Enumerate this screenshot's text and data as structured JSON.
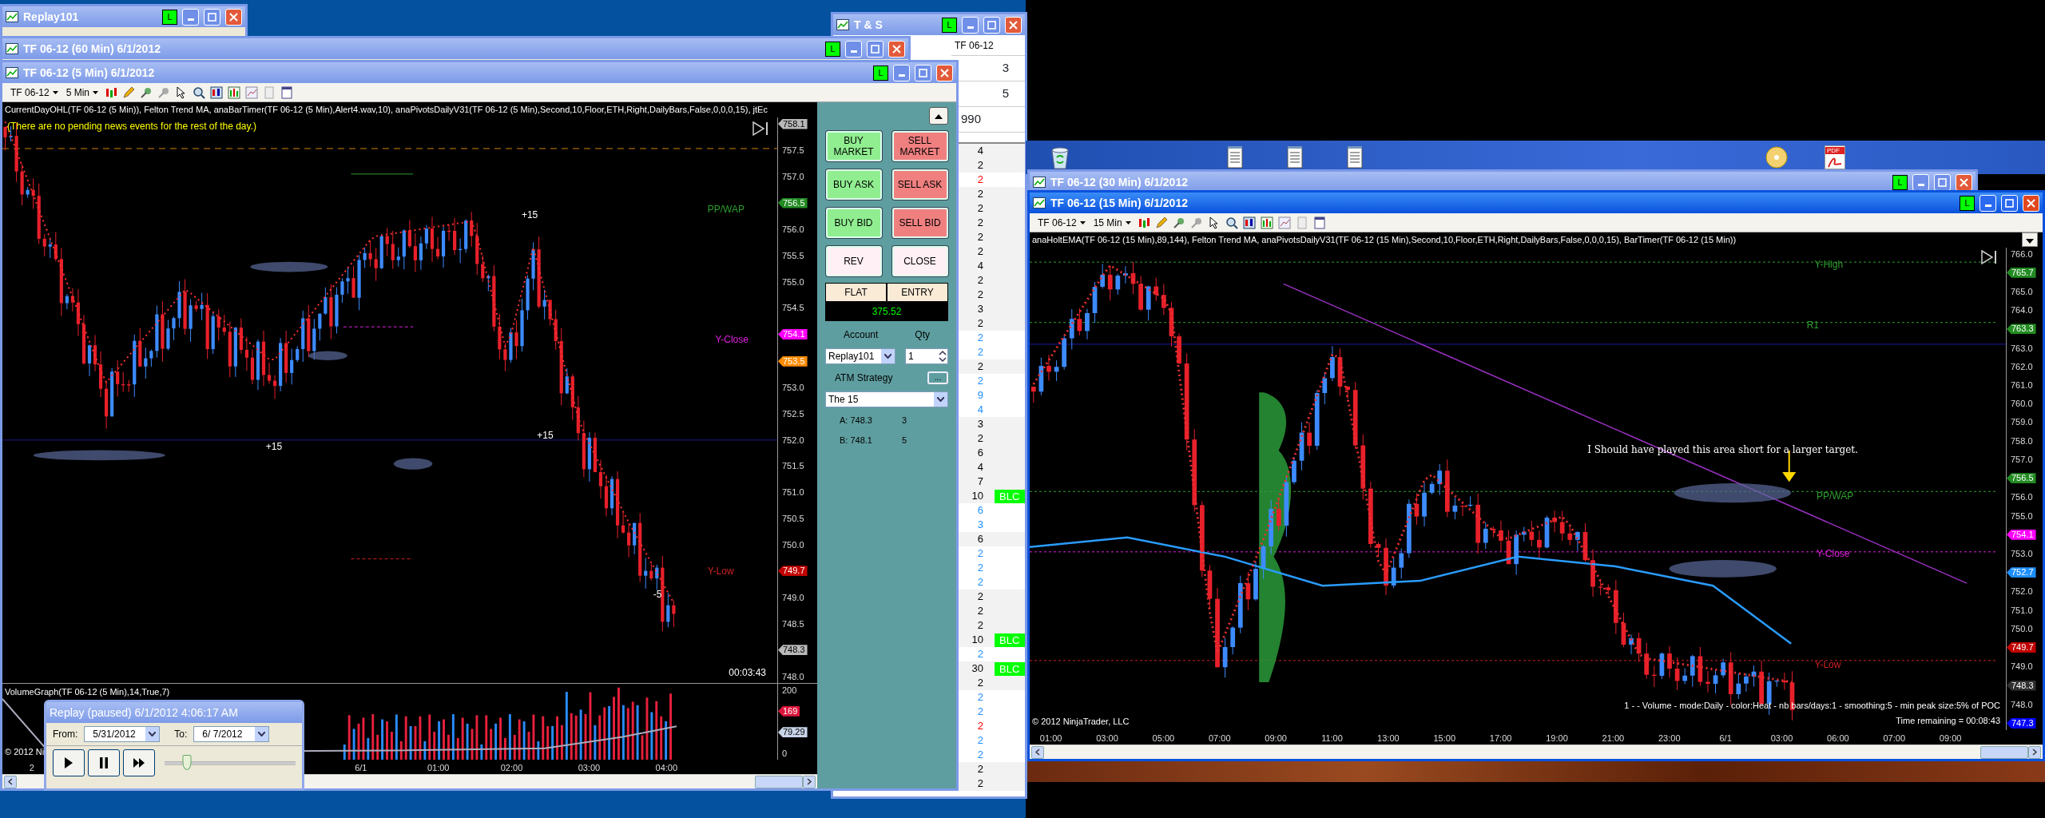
{
  "replay_window": {
    "title": "Replay101",
    "link": "L",
    "active": false
  },
  "ts_window": {
    "title": "T & S",
    "link": "L",
    "active": false,
    "instrument": "TF 06-12",
    "header_rows": [
      "3",
      "5",
      "990"
    ],
    "rows": [
      {
        "size": "4",
        "color": "#000000"
      },
      {
        "size": "2",
        "color": "#000000"
      },
      {
        "size": "2",
        "color": "#ff0000"
      },
      {
        "size": "2",
        "color": "#000000"
      },
      {
        "size": "2",
        "color": "#000000"
      },
      {
        "size": "2",
        "color": "#000000"
      },
      {
        "size": "2",
        "color": "#000000"
      },
      {
        "size": "2",
        "color": "#000000"
      },
      {
        "size": "4",
        "color": "#000000"
      },
      {
        "size": "2",
        "color": "#000000"
      },
      {
        "size": "2",
        "color": "#000000"
      },
      {
        "size": "3",
        "color": "#000000"
      },
      {
        "size": "2",
        "color": "#000000"
      },
      {
        "size": "2",
        "color": "#1e8fff"
      },
      {
        "size": "2",
        "color": "#1e8fff"
      },
      {
        "size": "2",
        "color": "#000000"
      },
      {
        "size": "2",
        "color": "#1e8fff"
      },
      {
        "size": "9",
        "color": "#1e8fff"
      },
      {
        "size": "4",
        "color": "#1e8fff"
      },
      {
        "size": "3",
        "color": "#000000"
      },
      {
        "size": "2",
        "color": "#000000"
      },
      {
        "size": "6",
        "color": "#000000"
      },
      {
        "size": "4",
        "color": "#000000"
      },
      {
        "size": "7",
        "color": "#000000"
      },
      {
        "size": "10",
        "color": "#000000",
        "tag": "BLC"
      },
      {
        "size": "6",
        "color": "#1e8fff"
      },
      {
        "size": "3",
        "color": "#1e8fff"
      },
      {
        "size": "6",
        "color": "#000000"
      },
      {
        "size": "2",
        "color": "#1e8fff"
      },
      {
        "size": "2",
        "color": "#1e8fff"
      },
      {
        "size": "2",
        "color": "#1e8fff"
      },
      {
        "size": "2",
        "color": "#000000"
      },
      {
        "size": "2",
        "color": "#000000"
      },
      {
        "size": "2",
        "color": "#000000"
      },
      {
        "size": "10",
        "color": "#000000",
        "tag": "BLC"
      },
      {
        "size": "2",
        "color": "#1e8fff"
      },
      {
        "size": "30",
        "color": "#000000",
        "tag": "BLC"
      },
      {
        "size": "2",
        "color": "#000000"
      },
      {
        "size": "2",
        "color": "#1e8fff"
      },
      {
        "size": "2",
        "color": "#1e8fff"
      },
      {
        "size": "2",
        "color": "#ff0000"
      },
      {
        "size": "2",
        "color": "#1e8fff"
      },
      {
        "size": "2",
        "color": "#1e8fff"
      },
      {
        "size": "2",
        "color": "#000000"
      },
      {
        "size": "2",
        "color": "#000000"
      }
    ]
  },
  "chart_60": {
    "title": "TF 06-12 (60 Min)  6/1/2012",
    "link": "L",
    "active": false
  },
  "chart_5": {
    "title": "TF 06-12 (5 Min)  6/1/2012",
    "link": "L",
    "active": false,
    "instrument": "TF 06-12",
    "interval": "5 Min",
    "indicators": "CurrentDayOHL(TF 06-12 (5 Min)), Felton Trend MA, anaBarTimer(TF 06-12 (5 Min),Alert4.wav,10), anaPivotsDailyV31(TF 06-12 (5 Min),Second,10,Floor,ETH,Right,DailyBars,False,0,0,0,15), jtEc",
    "news": "(There are no pending news events for the rest of the day.)",
    "labels": [
      {
        "text": "+15",
        "kind": "trade"
      },
      {
        "text": "+15",
        "kind": "trade"
      },
      {
        "text": "+15",
        "kind": "trade"
      },
      {
        "text": "-5",
        "kind": "trade"
      },
      {
        "text": "PP/WAP",
        "kind": "pivot",
        "color": "#2e9e2e"
      },
      {
        "text": "Y-Close",
        "kind": "pivot",
        "color": "#e020e0"
      },
      {
        "text": "Y-Low",
        "kind": "pivot",
        "color": "#d02020"
      }
    ],
    "timer": "00:03:43",
    "price_axis": [
      {
        "text": "758.1",
        "kind": "marker",
        "color": "#b8b8b8"
      },
      {
        "text": "757.5",
        "kind": "tick"
      },
      {
        "text": "757.0",
        "kind": "tick"
      },
      {
        "text": "756.5",
        "kind": "marker",
        "color": "#228b22"
      },
      {
        "text": "756.0",
        "kind": "tick"
      },
      {
        "text": "755.5",
        "kind": "tick"
      },
      {
        "text": "755.0",
        "kind": "tick"
      },
      {
        "text": "754.5",
        "kind": "tick"
      },
      {
        "text": "754.1",
        "kind": "marker",
        "color": "#ff00ff"
      },
      {
        "text": "753.5",
        "kind": "marker",
        "color": "#ff8c00"
      },
      {
        "text": "753.0",
        "kind": "tick"
      },
      {
        "text": "752.5",
        "kind": "tick"
      },
      {
        "text": "752.0",
        "kind": "tick"
      },
      {
        "text": "751.5",
        "kind": "tick"
      },
      {
        "text": "751.0",
        "kind": "tick"
      },
      {
        "text": "750.5",
        "kind": "tick"
      },
      {
        "text": "750.0",
        "kind": "tick"
      },
      {
        "text": "749.7",
        "kind": "marker",
        "color": "#c00000"
      },
      {
        "text": "749.0",
        "kind": "tick"
      },
      {
        "text": "748.5",
        "kind": "tick"
      },
      {
        "text": "748.3",
        "kind": "marker",
        "color": "#b8b8b8"
      },
      {
        "text": "748.0",
        "kind": "tick"
      }
    ],
    "volume": {
      "title": "VolumeGraph(TF 06-12 (5 Min),14,True,7)",
      "axis": [
        {
          "text": "200",
          "kind": "tick"
        },
        {
          "text": "169",
          "kind": "marker",
          "color": "#dc143c"
        },
        {
          "text": "79.29",
          "kind": "marker",
          "color": "#c8d4e8"
        },
        {
          "text": "0",
          "kind": "tick"
        }
      ]
    },
    "copyright": "© 2012 Ni",
    "time_axis": [
      "2",
      "6/1",
      "01:00",
      "02:00",
      "03:00",
      "04:00"
    ]
  },
  "order_panel": {
    "buttons": [
      {
        "label": "BUY MARKET",
        "kind": "buy"
      },
      {
        "label": "SELL MARKET",
        "kind": "sell"
      },
      {
        "label": "BUY ASK",
        "kind": "buy"
      },
      {
        "label": "SELL ASK",
        "kind": "sell"
      },
      {
        "label": "BUY BID",
        "kind": "buy"
      },
      {
        "label": "SELL BID",
        "kind": "sell"
      },
      {
        "label": "REV",
        "kind": "neutral"
      },
      {
        "label": "CLOSE",
        "kind": "neutral"
      }
    ],
    "position": "FLAT",
    "entry": "ENTRY",
    "pnl": "375.52",
    "account_label": "Account",
    "account": "Replay101",
    "qty_label": "Qty",
    "qty": "1",
    "atm_label": "ATM Strategy",
    "atm_button": "...",
    "atm": "The 15",
    "orders": [
      {
        "price": "A: 748.3",
        "qty": "3"
      },
      {
        "price": "B: 748.1",
        "qty": "5"
      }
    ]
  },
  "replay_control": {
    "title": "Replay (paused) 6/1/2012 4:06:17 AM",
    "from_label": "From:",
    "from": "5/31/2012",
    "to_label": "To:",
    "to": "6/ 7/2012",
    "level": 0.17
  },
  "desktop_icons": [
    {
      "kind": "recycle"
    },
    {
      "kind": "notepad"
    },
    {
      "kind": "notepad"
    },
    {
      "kind": "notepad"
    },
    {
      "kind": "disc"
    },
    {
      "kind": "pdf",
      "label": "PDF"
    }
  ],
  "chart_30": {
    "title": "TF 06-12 (30 Min)  6/1/2012",
    "link": "L",
    "active": false
  },
  "chart_15": {
    "title": "TF 06-12 (15 Min)  6/1/2012",
    "link": "L",
    "active": true,
    "instrument": "TF 06-12",
    "interval": "15 Min",
    "indicators": "anaHoltEMA(TF 06-12 (15 Min),89,144), Felton Trend MA, anaPivotsDailyV31(TF 06-12 (15 Min),Second,10,Floor,ETH,Right,DailyBars,False,0,0,0,15), BarTimer(TF 06-12 (15 Min))",
    "labels": [
      {
        "text": "Y-High",
        "kind": "pivot",
        "color": "#2e9e2e"
      },
      {
        "text": "R1",
        "kind": "pivot",
        "color": "#2e9e2e"
      },
      {
        "text": "I Should have played this area short for a larger target.",
        "kind": "note"
      },
      {
        "text": "PP/WAP",
        "kind": "pivot",
        "color": "#2e9e2e"
      },
      {
        "text": "Y-Close",
        "kind": "pivot",
        "color": "#e020e0"
      },
      {
        "text": "Y-Low",
        "kind": "pivot",
        "color": "#d02020"
      }
    ],
    "profile_info": "1 -  - Volume - mode:Daily - color:Heat - nb bars/days:1 - smoothing:5 - min peak size:5% of POC",
    "timer": "Time remaining = 00:08:43",
    "copyright": "© 2012 NinjaTrader, LLC",
    "price_axis": [
      {
        "text": "766.0",
        "kind": "tick"
      },
      {
        "text": "765.7",
        "kind": "marker",
        "color": "#228b22"
      },
      {
        "text": "765.0",
        "kind": "tick"
      },
      {
        "text": "764.0",
        "kind": "tick"
      },
      {
        "text": "763.3",
        "kind": "marker",
        "color": "#228b22"
      },
      {
        "text": "763.0",
        "kind": "tick"
      },
      {
        "text": "762.0",
        "kind": "tick"
      },
      {
        "text": "761.0",
        "kind": "tick"
      },
      {
        "text": "760.0",
        "kind": "tick"
      },
      {
        "text": "759.0",
        "kind": "tick"
      },
      {
        "text": "758.0",
        "kind": "tick"
      },
      {
        "text": "757.0",
        "kind": "tick"
      },
      {
        "text": "756.5",
        "kind": "marker",
        "color": "#228b22"
      },
      {
        "text": "756.0",
        "kind": "tick"
      },
      {
        "text": "755.0",
        "kind": "tick"
      },
      {
        "text": "754.1",
        "kind": "marker",
        "color": "#ff00ff"
      },
      {
        "text": "753.0",
        "kind": "tick"
      },
      {
        "text": "752.7",
        "kind": "marker",
        "color": "#1e8fff"
      },
      {
        "text": "752.0",
        "kind": "tick"
      },
      {
        "text": "751.0",
        "kind": "tick"
      },
      {
        "text": "750.0",
        "kind": "tick"
      },
      {
        "text": "749.7",
        "kind": "marker",
        "color": "#c00000"
      },
      {
        "text": "749.0",
        "kind": "tick"
      },
      {
        "text": "748.3",
        "kind": "marker",
        "color": "#303030"
      },
      {
        "text": "748.0",
        "kind": "tick"
      },
      {
        "text": "747.3",
        "kind": "marker",
        "color": "#0000ff"
      }
    ],
    "time_axis": [
      "01:00",
      "03:00",
      "05:00",
      "07:00",
      "09:00",
      "11:00",
      "13:00",
      "15:00",
      "17:00",
      "19:00",
      "21:00",
      "23:00",
      "6/1",
      "03:00",
      "06:00",
      "07:00",
      "09:00"
    ]
  }
}
